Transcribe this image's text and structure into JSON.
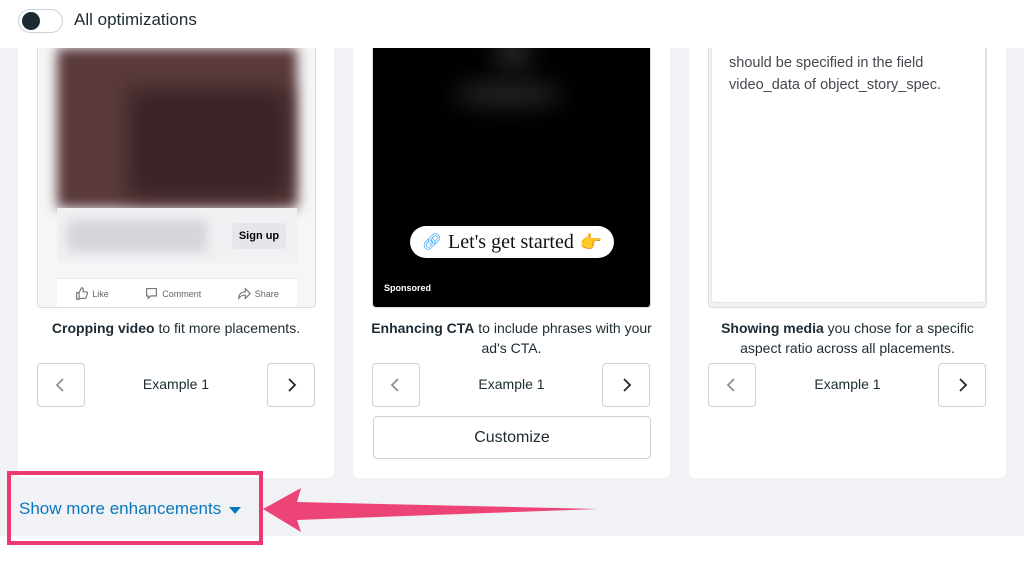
{
  "toggle": {
    "label": "All optimizations",
    "state": "off"
  },
  "cards": [
    {
      "preview": {
        "signup_label": "Sign up",
        "actions": [
          "Like",
          "Comment",
          "Share"
        ]
      },
      "description_bold": "Cropping video",
      "description_rest": " to fit more placements.",
      "example_label": "Example 1"
    },
    {
      "preview": {
        "cta_text": "Let's get started",
        "sponsored_label": "Sponsored"
      },
      "description_bold": "Enhancing CTA",
      "description_rest": " to include phrases with your ad's CTA.",
      "example_label": "Example 1",
      "customize_label": "Customize"
    },
    {
      "preview": {
        "text": "should be specified in the field video_data of object_story_spec."
      },
      "description_bold": "Showing media",
      "description_rest": " you chose for a specific aspect ratio across all placements.",
      "example_label": "Example 1"
    }
  ],
  "show_more": {
    "label": "Show more enhancements"
  },
  "colors": {
    "highlight": "#ec3a71",
    "link": "#0a78be",
    "background": "#f1f2f5"
  }
}
